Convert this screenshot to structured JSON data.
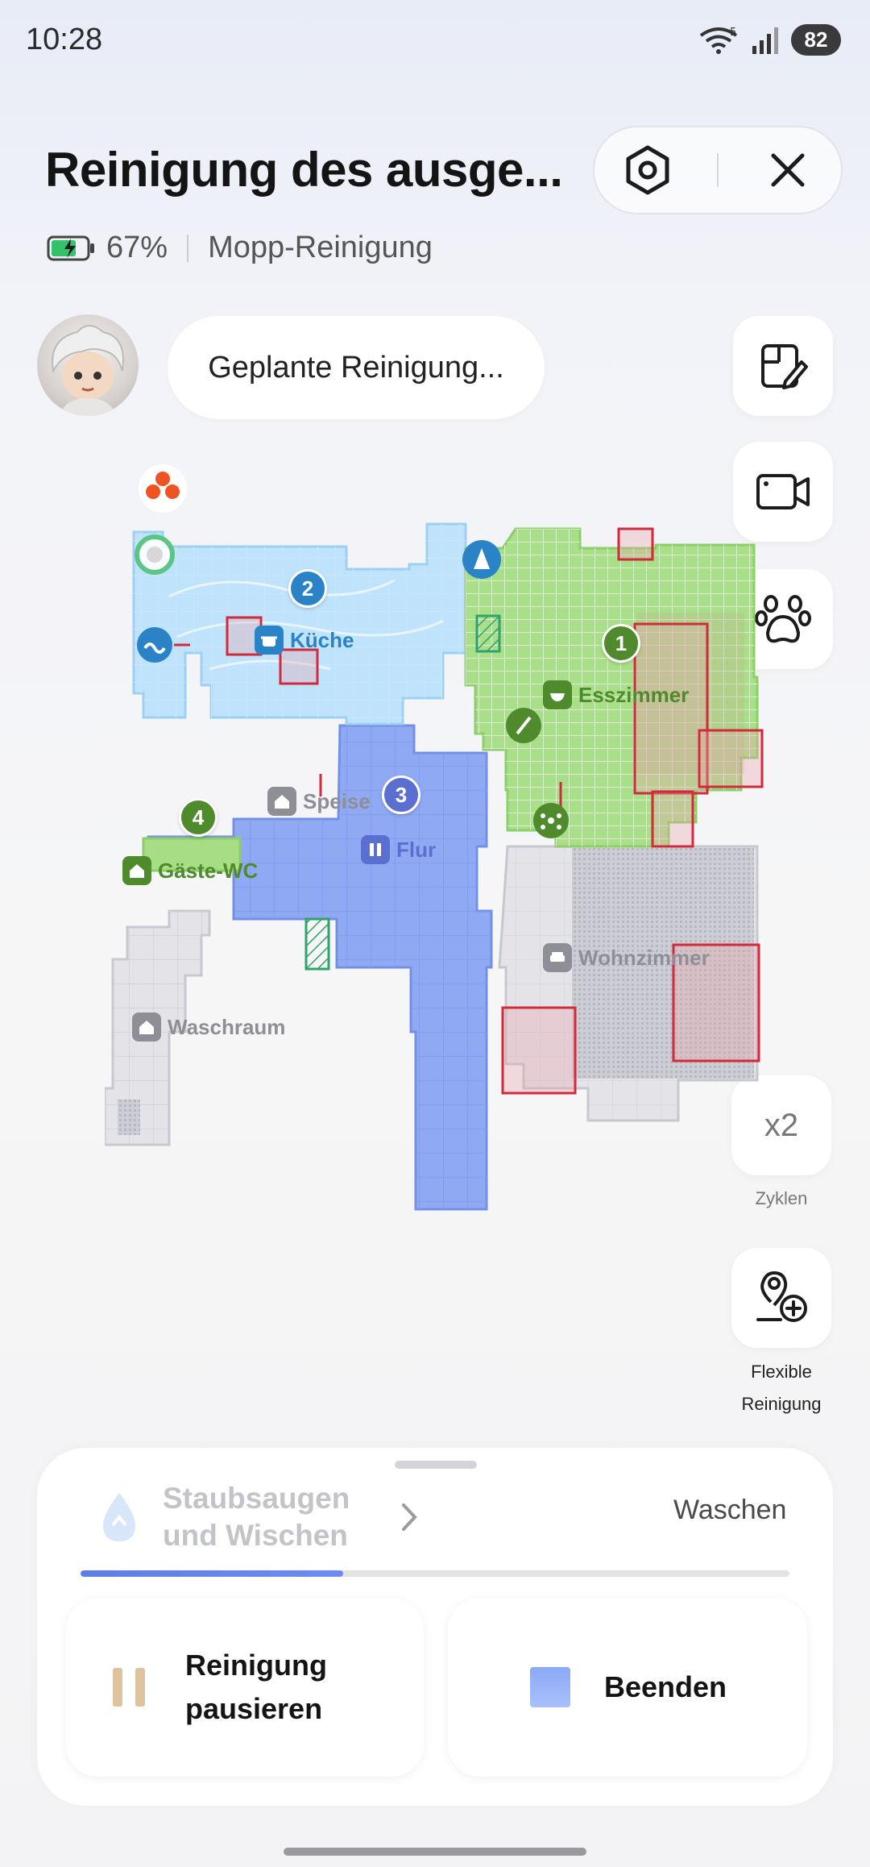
{
  "status_bar": {
    "time": "10:28",
    "battery": "82",
    "network": "5"
  },
  "header": {
    "title": "Reinigung des ausge...",
    "battery_percent": "67%",
    "mode": "Mopp-Reinigung",
    "settings_icon": "hexagon-settings-icon",
    "close_icon": "close-icon"
  },
  "bubble": {
    "text": "Geplante Reinigung..."
  },
  "side_tools": {
    "edit_map_icon": "map-edit-icon",
    "camera_icon": "video-camera-icon",
    "pet_icon": "paw-icon",
    "cycles_value": "x2",
    "cycles_label": "Zyklen",
    "flexible_label_1": "Flexible",
    "flexible_label_2": "Reinigung"
  },
  "map": {
    "rooms": [
      {
        "name": "Küche",
        "order": "2",
        "color": "#2a83c6"
      },
      {
        "name": "Esszimmer",
        "order": "1",
        "color": "#4f8a2d"
      },
      {
        "name": "Speise",
        "order": "",
        "color": "#8e8e96"
      },
      {
        "name": "Flur",
        "order": "3",
        "color": "#5a6fd0"
      },
      {
        "name": "Gäste-WC",
        "order": "4",
        "color": "#4f8a2d"
      },
      {
        "name": "Wohnzimmer",
        "order": "",
        "color": "#8e8e96"
      },
      {
        "name": "Waschraum",
        "order": "",
        "color": "#8e8e96"
      }
    ]
  },
  "bottom_panel": {
    "mode_current_line1": "Staubsaugen",
    "mode_current_line2": "und Wischen",
    "mode_next": "Waschen",
    "progress": 0.37,
    "pause_line1": "Reinigung",
    "pause_line2": "pausieren",
    "stop_label": "Beenden"
  }
}
